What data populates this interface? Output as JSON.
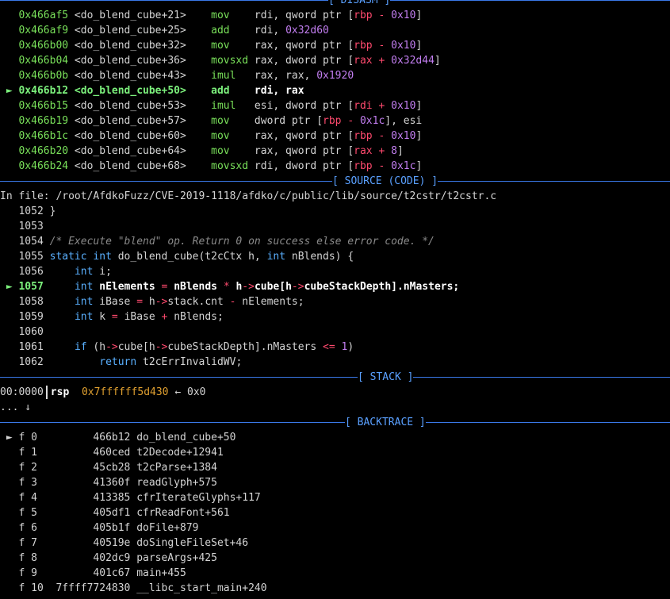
{
  "colors": {
    "background": "#000000",
    "separator": "#3a78e8",
    "current_line": "#7cf07c",
    "address": "#79e05a",
    "keyword": "#5ab0ff",
    "operator": "#ff4a6e",
    "number": "#c27ef0",
    "stack_value": "#e0a030"
  },
  "disasm": {
    "header": "[ DISASM ]",
    "marker": "►",
    "rows": [
      {
        "addr": "0x466af5",
        "sym": "<do_blend_cube+21>",
        "mn": "mov",
        "ops": [
          [
            "c",
            "rdi, qword ptr ["
          ],
          [
            "op",
            "rbp - "
          ],
          [
            "num",
            "0x10"
          ],
          [
            "c",
            "]"
          ]
        ]
      },
      {
        "addr": "0x466af9",
        "sym": "<do_blend_cube+25>",
        "mn": "add",
        "ops": [
          [
            "c",
            "rdi, "
          ],
          [
            "num",
            "0x32d60"
          ]
        ]
      },
      {
        "addr": "0x466b00",
        "sym": "<do_blend_cube+32>",
        "mn": "mov",
        "ops": [
          [
            "c",
            "rax, qword ptr ["
          ],
          [
            "op",
            "rbp - "
          ],
          [
            "num",
            "0x10"
          ],
          [
            "c",
            "]"
          ]
        ]
      },
      {
        "addr": "0x466b04",
        "sym": "<do_blend_cube+36>",
        "mn": "movsxd",
        "ops": [
          [
            "c",
            "rax, dword ptr ["
          ],
          [
            "op",
            "rax + "
          ],
          [
            "num",
            "0x32d44"
          ],
          [
            "c",
            "]"
          ]
        ]
      },
      {
        "addr": "0x466b0b",
        "sym": "<do_blend_cube+43>",
        "mn": "imul",
        "ops": [
          [
            "c",
            "rax, rax, "
          ],
          [
            "num",
            "0x1920"
          ]
        ]
      },
      {
        "addr": "0x466b12",
        "sym": "<do_blend_cube+50>",
        "mn": "add",
        "ops": [
          [
            "wb",
            "rdi, rax"
          ]
        ],
        "current": true
      },
      {
        "addr": "0x466b15",
        "sym": "<do_blend_cube+53>",
        "mn": "imul",
        "ops": [
          [
            "c",
            "esi, dword ptr ["
          ],
          [
            "op",
            "rdi + "
          ],
          [
            "num",
            "0x10"
          ],
          [
            "c",
            "]"
          ]
        ]
      },
      {
        "addr": "0x466b19",
        "sym": "<do_blend_cube+57>",
        "mn": "mov",
        "ops": [
          [
            "c",
            "dword ptr ["
          ],
          [
            "op",
            "rbp - "
          ],
          [
            "num",
            "0x1c"
          ],
          [
            "c",
            "], esi"
          ]
        ]
      },
      {
        "addr": "0x466b1c",
        "sym": "<do_blend_cube+60>",
        "mn": "mov",
        "ops": [
          [
            "c",
            "rax, qword ptr ["
          ],
          [
            "op",
            "rbp - "
          ],
          [
            "num",
            "0x10"
          ],
          [
            "c",
            "]"
          ]
        ]
      },
      {
        "addr": "0x466b20",
        "sym": "<do_blend_cube+64>",
        "mn": "mov",
        "ops": [
          [
            "c",
            "rax, qword ptr ["
          ],
          [
            "op",
            "rax + "
          ],
          [
            "num",
            "8"
          ],
          [
            "c",
            "]"
          ]
        ]
      },
      {
        "addr": "0x466b24",
        "sym": "<do_blend_cube+68>",
        "mn": "movsxd",
        "ops": [
          [
            "c",
            "rdi, dword ptr ["
          ],
          [
            "op",
            "rbp - "
          ],
          [
            "num",
            "0x1c"
          ],
          [
            "c",
            "]"
          ]
        ]
      }
    ]
  },
  "source": {
    "header": "[ SOURCE (CODE) ]",
    "file_line": "In file: /root/AfdkoFuzz/CVE-2019-1118/afdko/c/public/lib/source/t2cstr/t2cstr.c",
    "rows": [
      {
        "num": "1052",
        "parts": [
          [
            "c",
            "}"
          ]
        ]
      },
      {
        "num": "1053",
        "parts": []
      },
      {
        "num": "1054",
        "parts": [
          [
            "cmt",
            "/* Execute \"blend\" op. Return 0 on success else error code. */"
          ]
        ]
      },
      {
        "num": "1055",
        "parts": [
          [
            "kw",
            "static int "
          ],
          [
            "c",
            "do_blend_cube(t2cCtx h, "
          ],
          [
            "kw",
            "int "
          ],
          [
            "c",
            "nBlends) {"
          ]
        ]
      },
      {
        "num": "1056",
        "parts": [
          [
            "c",
            "    "
          ],
          [
            "kw",
            "int "
          ],
          [
            "c",
            "i;"
          ]
        ]
      },
      {
        "num": "1057",
        "current": true,
        "parts": [
          [
            "c",
            "    "
          ],
          [
            "kw",
            "int "
          ],
          [
            "wb",
            "nElements "
          ],
          [
            "op",
            "= "
          ],
          [
            "wb",
            "nBlends "
          ],
          [
            "op",
            "* "
          ],
          [
            "wb",
            "h"
          ],
          [
            "op",
            "->"
          ],
          [
            "wb",
            "cube[h"
          ],
          [
            "op",
            "->"
          ],
          [
            "wb",
            "cubeStackDepth].nMasters;"
          ]
        ]
      },
      {
        "num": "1058",
        "parts": [
          [
            "c",
            "    "
          ],
          [
            "kw",
            "int "
          ],
          [
            "c",
            "iBase "
          ],
          [
            "op",
            "= "
          ],
          [
            "c",
            "h"
          ],
          [
            "op",
            "->"
          ],
          [
            "c",
            "stack.cnt "
          ],
          [
            "op",
            "- "
          ],
          [
            "c",
            "nElements;"
          ]
        ]
      },
      {
        "num": "1059",
        "parts": [
          [
            "c",
            "    "
          ],
          [
            "kw",
            "int "
          ],
          [
            "c",
            "k "
          ],
          [
            "op",
            "= "
          ],
          [
            "c",
            "iBase "
          ],
          [
            "op",
            "+ "
          ],
          [
            "c",
            "nBlends;"
          ]
        ]
      },
      {
        "num": "1060",
        "parts": []
      },
      {
        "num": "1061",
        "parts": [
          [
            "c",
            "    "
          ],
          [
            "kw",
            "if "
          ],
          [
            "c",
            "(h"
          ],
          [
            "op",
            "->"
          ],
          [
            "c",
            "cube[h"
          ],
          [
            "op",
            "->"
          ],
          [
            "c",
            "cubeStackDepth].nMasters "
          ],
          [
            "op",
            "<= "
          ],
          [
            "num",
            "1"
          ],
          [
            "c",
            ")"
          ]
        ]
      },
      {
        "num": "1062",
        "parts": [
          [
            "c",
            "        "
          ],
          [
            "kw",
            "return "
          ],
          [
            "c",
            "t2cErrInvalidWV;"
          ]
        ]
      }
    ]
  },
  "stack": {
    "header": "[ STACK ]",
    "offset": "00:0000",
    "reg": "rsp",
    "addr": "0x7ffffff5d430",
    "arrow_val": "← 0x0",
    "more": "... ↓"
  },
  "backtrace": {
    "header": "[ BACKTRACE ]",
    "frames": [
      {
        "frame": "f 0",
        "addr": "466b12",
        "sym": "do_blend_cube+50",
        "current": true
      },
      {
        "frame": "f 1",
        "addr": "460ced",
        "sym": "t2Decode+12941"
      },
      {
        "frame": "f 2",
        "addr": "45cb28",
        "sym": "t2cParse+1384"
      },
      {
        "frame": "f 3",
        "addr": "41360f",
        "sym": "readGlyph+575"
      },
      {
        "frame": "f 4",
        "addr": "413385",
        "sym": "cfrIterateGlyphs+117"
      },
      {
        "frame": "f 5",
        "addr": "405df1",
        "sym": "cfrReadFont+561"
      },
      {
        "frame": "f 6",
        "addr": "405b1f",
        "sym": "doFile+879"
      },
      {
        "frame": "f 7",
        "addr": "40519e",
        "sym": "doSingleFileSet+46"
      },
      {
        "frame": "f 8",
        "addr": "402dc9",
        "sym": "parseArgs+425"
      },
      {
        "frame": "f 9",
        "addr": "401c67",
        "sym": "main+455"
      },
      {
        "frame": "f 10",
        "addr": "7ffff7724830",
        "sym": "__libc_start_main+240"
      }
    ]
  }
}
